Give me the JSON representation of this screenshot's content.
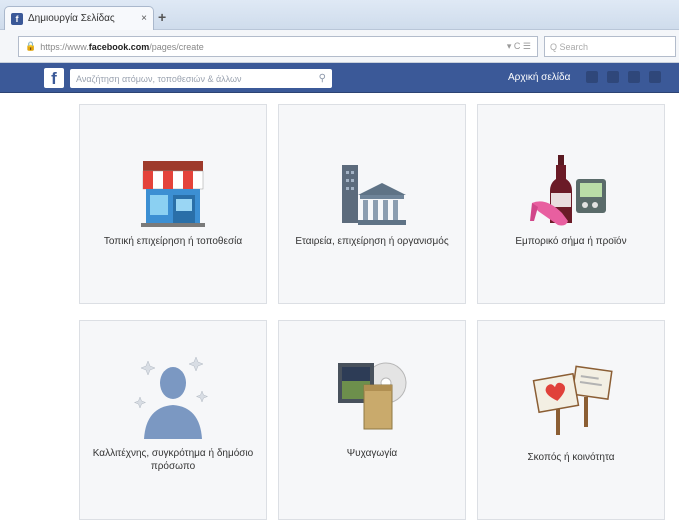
{
  "browser": {
    "tab_title": "Δημιουργία Σελίδας",
    "tab_close": "×",
    "new_tab": "+",
    "url_prefix": "https://www.",
    "url_host": "facebook.com",
    "url_path": "/pages/create",
    "url_tools": "▾ C ☰",
    "search_placeholder": "Q  Search"
  },
  "facebook": {
    "logo": "f",
    "search_placeholder": "Αναζήτηση ατόμων, τοποθεσιών & άλλων",
    "user_label": "Αρχική σελίδα"
  },
  "categories": [
    {
      "label": "Τοπική επιχείρηση ή τοποθεσία",
      "icon": "storefront-icon"
    },
    {
      "label": "Εταιρεία, επιχείρηση ή οργανισμός",
      "icon": "building-icon"
    },
    {
      "label": "Εμπορικό σήμα ή προϊόν",
      "icon": "products-icon"
    },
    {
      "label": "Καλλιτέχνης, συγκρότημα ή δημόσιο πρόσωπο",
      "icon": "person-stars-icon"
    },
    {
      "label": "Ψυχαγωγία",
      "icon": "movie-icon"
    },
    {
      "label": "Σκοπός ή κοινότητα",
      "icon": "signs-icon"
    }
  ],
  "colors": {
    "fb_blue": "#3b5998",
    "card_bg": "#f6f7f9"
  }
}
